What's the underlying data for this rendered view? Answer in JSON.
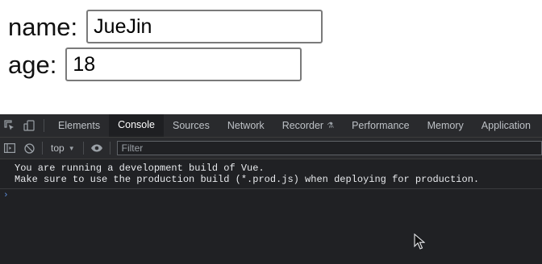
{
  "form": {
    "name_label": "name:",
    "name_value": "JueJin",
    "age_label": "age:",
    "age_value": "18"
  },
  "devtools": {
    "tabs": [
      {
        "label": "Elements"
      },
      {
        "label": "Console",
        "active": true
      },
      {
        "label": "Sources"
      },
      {
        "label": "Network"
      },
      {
        "label": "Recorder"
      },
      {
        "label": "Performance"
      },
      {
        "label": "Memory"
      },
      {
        "label": "Application"
      }
    ],
    "context": "top",
    "filter_placeholder": "Filter",
    "messages": [
      "You are running a development build of Vue.",
      "Make sure to use the production build (*.prod.js) when deploying for production."
    ],
    "prompt": "›"
  },
  "colors": {
    "devtools_bg": "#202124",
    "tabbar_bg": "#292a2d",
    "prompt_blue": "#5d8fdb"
  }
}
